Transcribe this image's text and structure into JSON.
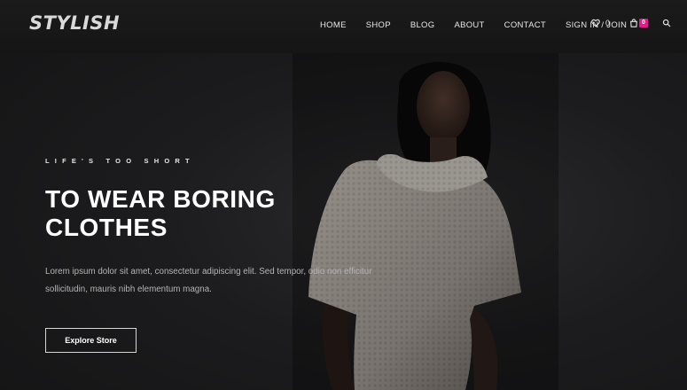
{
  "brand": {
    "logo_text": "STYLISH"
  },
  "nav": {
    "items": [
      "HOME",
      "SHOP",
      "BLOG",
      "ABOUT",
      "CONTACT",
      "SIGN IN / JOIN"
    ]
  },
  "header_icons": {
    "wishlist_icon": "heart-icon",
    "wishlist_count": "0",
    "cart_icon": "shopping-bag-icon",
    "cart_count": "0",
    "search_icon": "search-icon"
  },
  "hero": {
    "eyebrow": "LIFE'S TOO SHORT",
    "headline_line1": "TO WEAR BORING",
    "headline_line2": "CLOTHES",
    "body": "Lorem ipsum dolor sit amet, consectetur adipiscing elit. Sed tempor, odio non efficitur sollicitudin, mauris nibh elementum magna.",
    "cta_label": "Explore Store"
  },
  "colors": {
    "accent": "#e5198b",
    "background": "#1c1c1e",
    "text": "#ffffff"
  }
}
